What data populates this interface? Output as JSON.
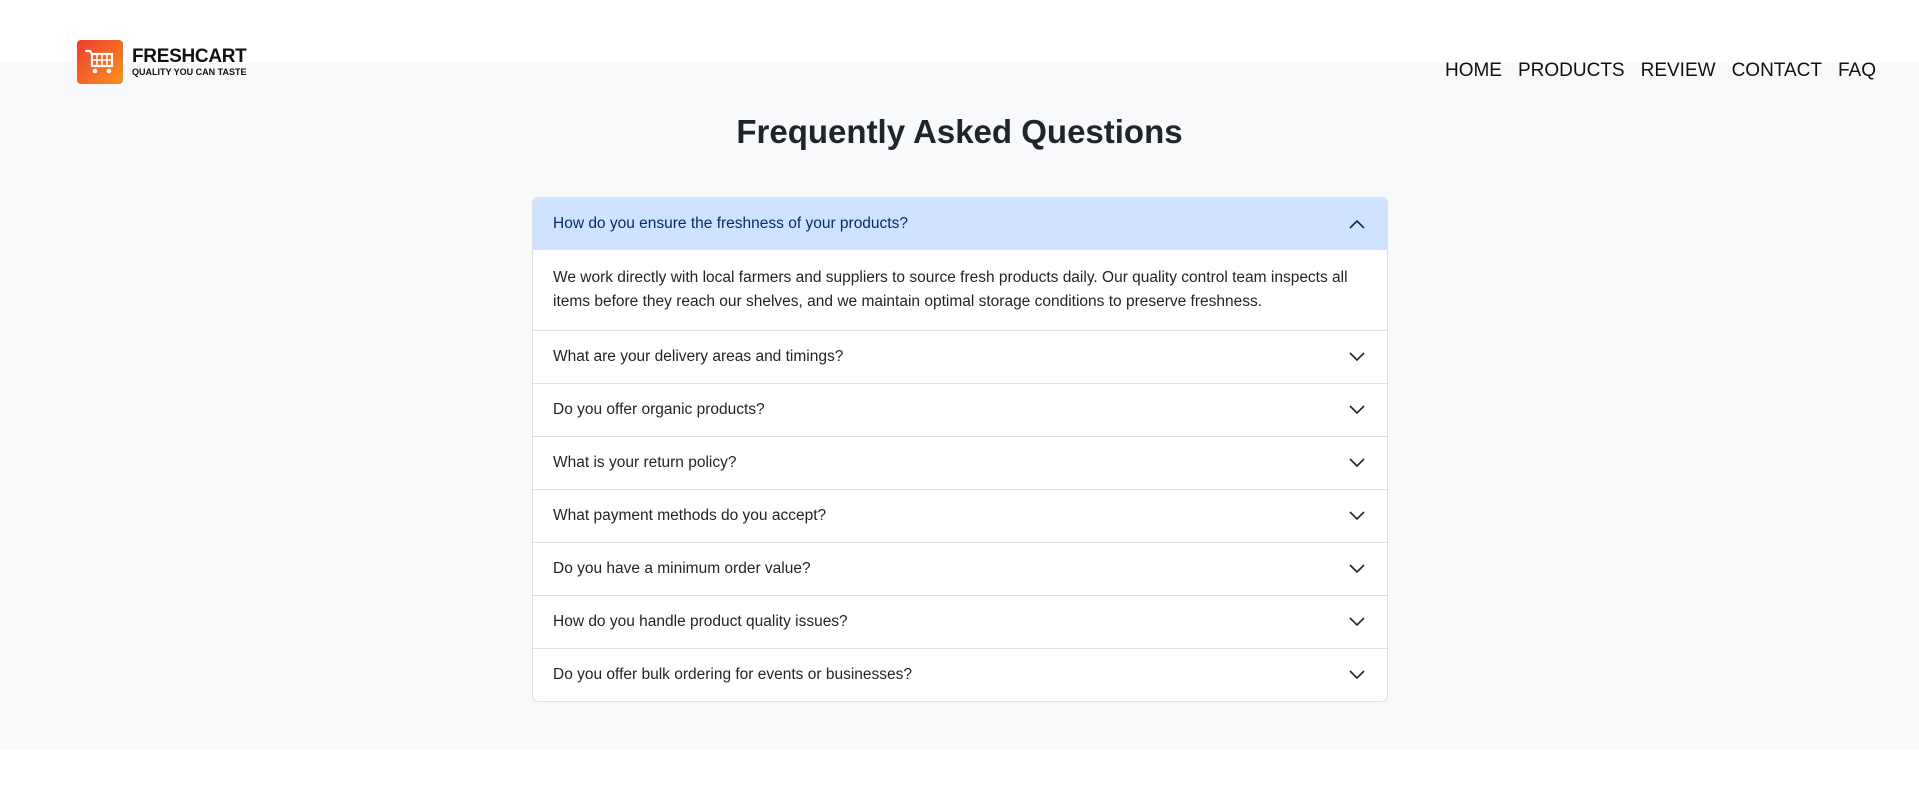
{
  "brand": {
    "name": "FRESHCART",
    "tagline": "QUALITY YOU CAN TASTE",
    "logo_icon": "cart-icon",
    "logo_gradient": [
      "#ef3b2d",
      "#f7931e"
    ]
  },
  "nav": {
    "items": [
      {
        "label": "HOME"
      },
      {
        "label": "PRODUCTS"
      },
      {
        "label": "REVIEW"
      },
      {
        "label": "CONTACT"
      },
      {
        "label": "FAQ"
      }
    ]
  },
  "faq": {
    "title": "Frequently Asked Questions",
    "items": [
      {
        "question": "How do you ensure the freshness of your products?",
        "answer": "We work directly with local farmers and suppliers to source fresh products daily. Our quality control team inspects all items before they reach our shelves, and we maintain optimal storage conditions to preserve freshness.",
        "expanded": true
      },
      {
        "question": "What are your delivery areas and timings?",
        "expanded": false
      },
      {
        "question": "Do you offer organic products?",
        "expanded": false
      },
      {
        "question": "What is your return policy?",
        "expanded": false
      },
      {
        "question": "What payment methods do you accept?",
        "expanded": false
      },
      {
        "question": "Do you have a minimum order value?",
        "expanded": false
      },
      {
        "question": "How do you handle product quality issues?",
        "expanded": false
      },
      {
        "question": "Do you offer bulk ordering for events or businesses?",
        "expanded": false
      }
    ]
  },
  "colors": {
    "page_band": "#f8f9fa",
    "active_header": "#cfe2ff",
    "active_text": "#052c65",
    "border": "#dee2e6"
  }
}
